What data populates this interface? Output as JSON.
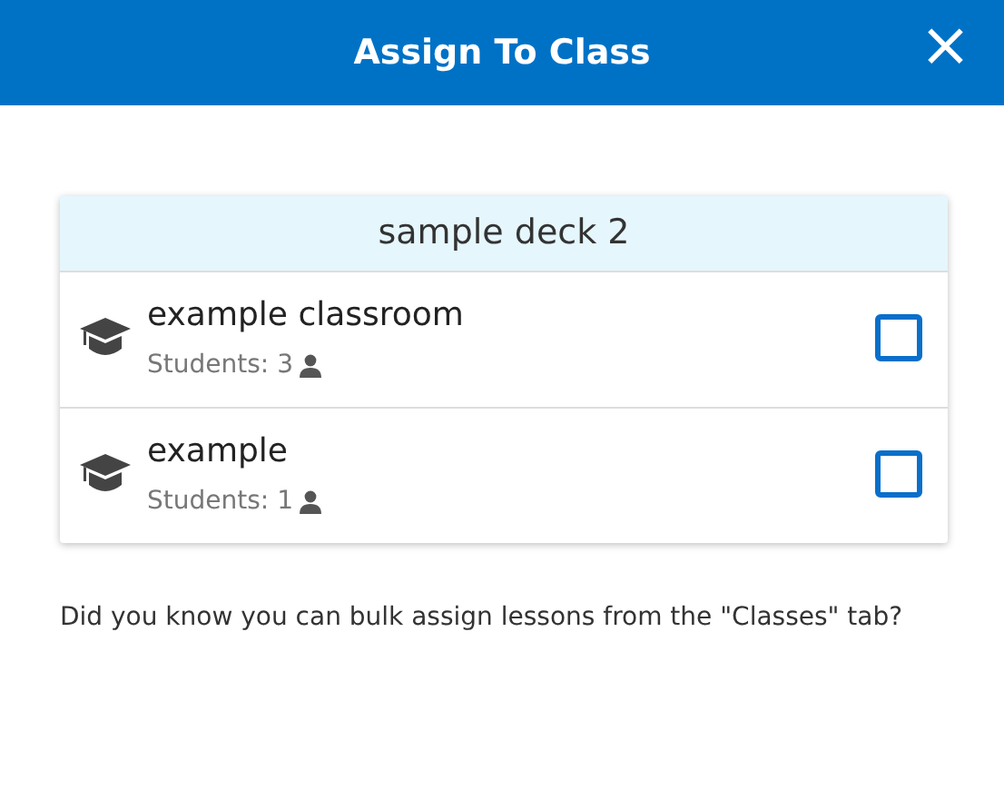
{
  "dialog": {
    "title": "Assign To Class",
    "close": "×"
  },
  "deck": {
    "title": "sample deck 2"
  },
  "classes": [
    {
      "name": "example classroom",
      "students": "Students: 3",
      "checked": false
    },
    {
      "name": "example",
      "students": "Students: 1",
      "checked": false
    }
  ],
  "tip": "Did you know you can bulk assign lessons from the \"Classes\" tab?"
}
